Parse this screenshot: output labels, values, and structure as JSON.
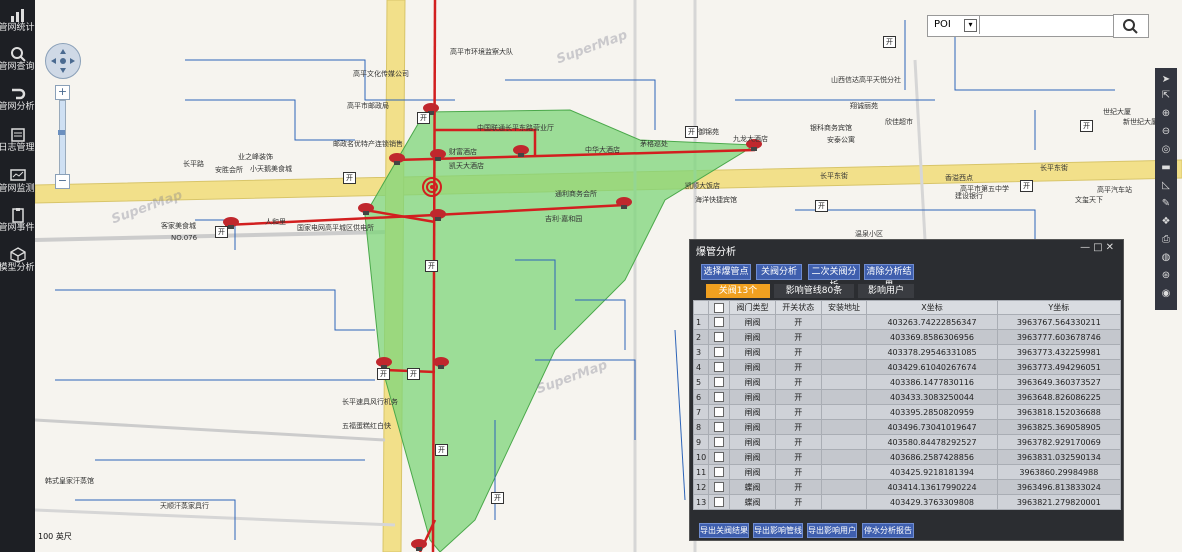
{
  "sidebar": {
    "items": [
      {
        "label": "管网统计",
        "icon": "bar-chart-icon"
      },
      {
        "label": "管网查询",
        "icon": "search-gear-icon"
      },
      {
        "label": "管网分析",
        "icon": "pipe-analysis-icon"
      },
      {
        "label": "日志管理",
        "icon": "log-icon"
      },
      {
        "label": "管网监测",
        "icon": "monitor-icon"
      },
      {
        "label": "管网事件",
        "icon": "clipboard-icon"
      },
      {
        "label": "模型分析",
        "icon": "cube-icon"
      }
    ]
  },
  "poi": {
    "select_value": "POI",
    "placeholder": ""
  },
  "map": {
    "labels": [
      "高平市环境监察大队",
      "高平文化传媒公司",
      "高平市邮政局",
      "中国联通长平东路营业厅",
      "山西信达高平天悦分社",
      "翔诚丽苑",
      "世纪大厦",
      "邮政名优特产连锁销售",
      "财富酒店",
      "凯天大酒店",
      "御锦苑",
      "九龙大酒店",
      "银科商务宾馆",
      "欣佳超市",
      "安泰公寓",
      "新世纪大厦",
      "中华大酒店",
      "业之峰装饰",
      "长平路",
      "安胜会所",
      "茅格巡处",
      "小天鹅美食城",
      "长平东街",
      "凯顺大饭店",
      "香溢西点",
      "建设银行",
      "长平东街",
      "高平市第五中学",
      "客家美食城",
      "NO.076",
      "人和里",
      "国家电网高平城区供电所",
      "温泉小区",
      "文玺天下",
      "海洋快捷宾馆",
      "通利商务会所",
      "吉利·嘉和园",
      "高平汽车站",
      "长平速具风行机务",
      "五福蛋糕红白快",
      "韩式皇家汗蒸馆",
      "天顺汗蒸家具行"
    ],
    "scale": "100 英尺"
  },
  "panel": {
    "title": "爆管分析",
    "buttons": [
      "选择爆管点",
      "关阀分析",
      "二次关阀分析",
      "清除分析结果"
    ],
    "tabs": [
      "关阀13个",
      "影响管线80条",
      "影响用户"
    ],
    "columns": [
      "",
      "阀门类型",
      "开关状态",
      "安装地址",
      "X坐标",
      "Y坐标"
    ],
    "rows": [
      {
        "n": "1",
        "type": "闸阀",
        "state": "开",
        "addr": "",
        "x": "403263.74222856347",
        "y": "3963767.564330211"
      },
      {
        "n": "2",
        "type": "闸阀",
        "state": "开",
        "addr": "",
        "x": "403369.8586306956",
        "y": "3963777.603678746"
      },
      {
        "n": "3",
        "type": "闸阀",
        "state": "开",
        "addr": "",
        "x": "403378.29546331085",
        "y": "3963773.432259981"
      },
      {
        "n": "4",
        "type": "闸阀",
        "state": "开",
        "addr": "",
        "x": "403429.61040267674",
        "y": "3963773.494296051"
      },
      {
        "n": "5",
        "type": "闸阀",
        "state": "开",
        "addr": "",
        "x": "403386.1477830116",
        "y": "3963649.360373527"
      },
      {
        "n": "6",
        "type": "闸阀",
        "state": "开",
        "addr": "",
        "x": "403433.3083250044",
        "y": "3963648.826086225"
      },
      {
        "n": "7",
        "type": "闸阀",
        "state": "开",
        "addr": "",
        "x": "403395.2850820959",
        "y": "3963818.152036688"
      },
      {
        "n": "8",
        "type": "闸阀",
        "state": "开",
        "addr": "",
        "x": "403496.73041019647",
        "y": "3963825.369058905"
      },
      {
        "n": "9",
        "type": "闸阀",
        "state": "开",
        "addr": "",
        "x": "403580.84478292527",
        "y": "3963782.929170069"
      },
      {
        "n": "10",
        "type": "闸阀",
        "state": "开",
        "addr": "",
        "x": "403686.2587428856",
        "y": "3963831.032590134"
      },
      {
        "n": "11",
        "type": "闸阀",
        "state": "开",
        "addr": "",
        "x": "403425.9218181394",
        "y": "3963860.29984988"
      },
      {
        "n": "12",
        "type": "蝶阀",
        "state": "开",
        "addr": "",
        "x": "403414.13617990224",
        "y": "3963496.813833024"
      },
      {
        "n": "13",
        "type": "蝶阀",
        "state": "开",
        "addr": "",
        "x": "403429.3763309808",
        "y": "3963821.279820001"
      }
    ],
    "footer": [
      "导出关阀结果",
      "导出影响管线",
      "导出影响用户",
      "停水分析报告"
    ]
  },
  "colors": {
    "polygon": "#7ed67a",
    "pipe": "#d21f1f",
    "road": "#f2e08a",
    "panel_bg": "#2b2d31",
    "tab_active": "#f0a020"
  }
}
